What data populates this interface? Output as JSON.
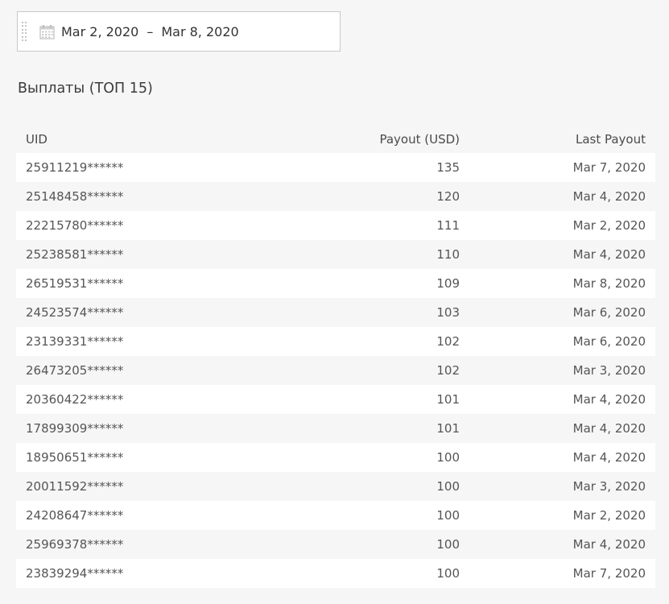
{
  "date_range": {
    "start": "Mar 2, 2020",
    "separator": "–",
    "end": "Mar 8, 2020"
  },
  "section_title": "Выплаты (ТОП 15)",
  "table": {
    "headers": {
      "uid": "UID",
      "payout": "Payout (USD)",
      "last_payout": "Last Payout"
    },
    "rows": [
      {
        "uid": "25911219******",
        "payout": "135",
        "last_payout": "Mar 7, 2020"
      },
      {
        "uid": "25148458******",
        "payout": "120",
        "last_payout": "Mar 4, 2020"
      },
      {
        "uid": "22215780******",
        "payout": "111",
        "last_payout": "Mar 2, 2020"
      },
      {
        "uid": "25238581******",
        "payout": "110",
        "last_payout": "Mar 4, 2020"
      },
      {
        "uid": "26519531******",
        "payout": "109",
        "last_payout": "Mar 8, 2020"
      },
      {
        "uid": "24523574******",
        "payout": "103",
        "last_payout": "Mar 6, 2020"
      },
      {
        "uid": "23139331******",
        "payout": "102",
        "last_payout": "Mar 6, 2020"
      },
      {
        "uid": "26473205******",
        "payout": "102",
        "last_payout": "Mar 3, 2020"
      },
      {
        "uid": "20360422******",
        "payout": "101",
        "last_payout": "Mar 4, 2020"
      },
      {
        "uid": "17899309******",
        "payout": "101",
        "last_payout": "Mar 4, 2020"
      },
      {
        "uid": "18950651******",
        "payout": "100",
        "last_payout": "Mar 4, 2020"
      },
      {
        "uid": "20011592******",
        "payout": "100",
        "last_payout": "Mar 3, 2020"
      },
      {
        "uid": "24208647******",
        "payout": "100",
        "last_payout": "Mar 2, 2020"
      },
      {
        "uid": "25969378******",
        "payout": "100",
        "last_payout": "Mar 4, 2020"
      },
      {
        "uid": "23839294******",
        "payout": "100",
        "last_payout": "Mar 7, 2020"
      }
    ]
  },
  "icons": {
    "calendar": "calendar-icon",
    "drag": "drag-handle-icon"
  },
  "colors": {
    "background": "#f6f6f6",
    "row_alt": "#ffffff",
    "border": "#c8c8c8",
    "text": "#555555"
  }
}
